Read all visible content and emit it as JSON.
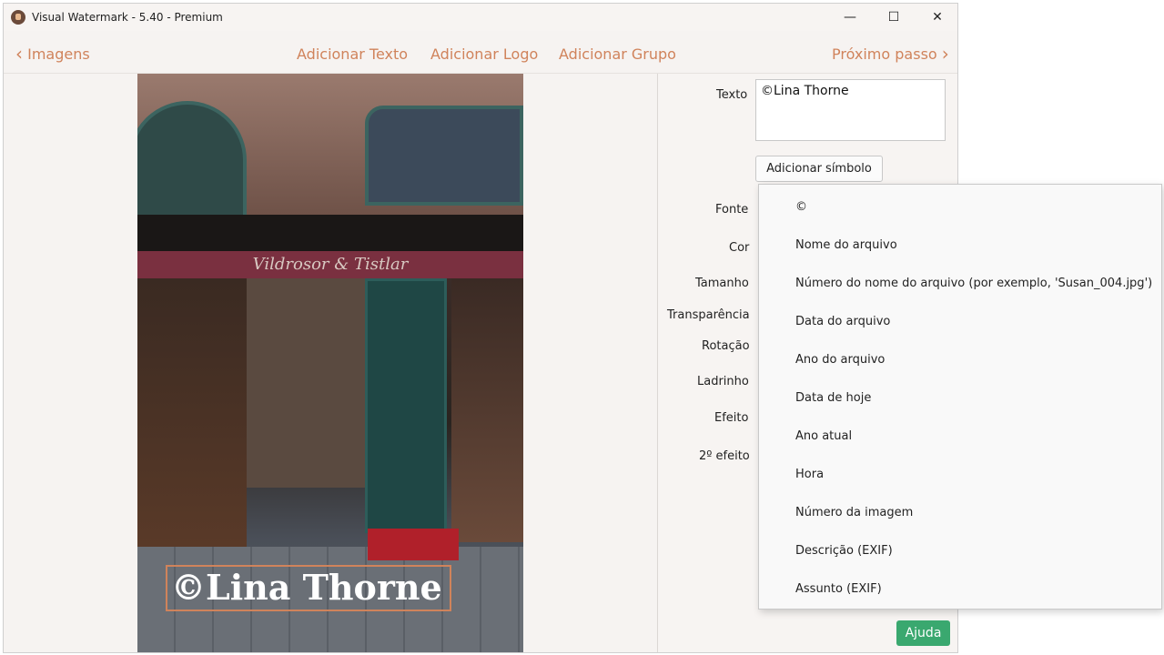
{
  "window": {
    "title": "Visual Watermark - 5.40 - Premium"
  },
  "window_controls": {
    "minimize": "—",
    "maximize": "☐",
    "close": "✕"
  },
  "nav": {
    "back_label": "Imagens",
    "add_text": "Adicionar Texto",
    "add_logo": "Adicionar Logo",
    "add_group": "Adicionar Grupo",
    "next_label": "Próximo passo"
  },
  "preview": {
    "shop_sign": "Vildrosor & Tistlar",
    "watermark_text": "©Lina Thorne"
  },
  "panel": {
    "labels": {
      "texto": "Texto",
      "fonte": "Fonte",
      "cor": "Cor",
      "tamanho": "Tamanho",
      "transparencia": "Transparência",
      "rotacao": "Rotação",
      "ladrinho": "Ladrinho",
      "efeito": "Efeito",
      "segundo_efeito": "2º efeito"
    },
    "text_value": "©Lina Thorne",
    "add_symbol_button": "Adicionar símbolo",
    "help_button": "Ajuda"
  },
  "symbol_menu": {
    "items": [
      "©",
      "Nome do arquivo",
      "Número do nome do arquivo (por exemplo, 'Susan_004.jpg')",
      "Data do arquivo",
      "Ano do arquivo",
      "Data de hoje",
      "Ano atual",
      "Hora",
      "Número da imagem",
      "Descrição (EXIF)",
      "Assunto (EXIF)"
    ]
  },
  "colors": {
    "accent": "#d0835b",
    "help_green": "#3aa86f"
  }
}
